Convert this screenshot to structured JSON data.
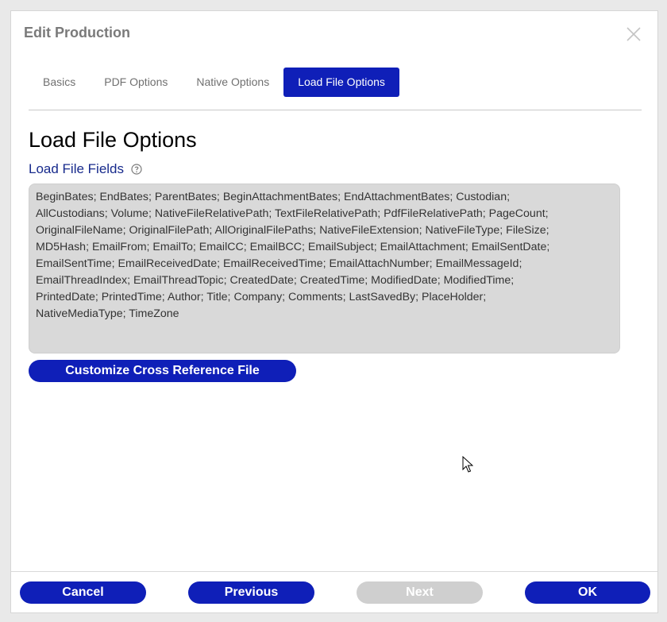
{
  "dialog": {
    "title": "Edit Production"
  },
  "tabs": [
    {
      "label": "Basics"
    },
    {
      "label": "PDF Options"
    },
    {
      "label": "Native Options"
    },
    {
      "label": "Load File Options"
    }
  ],
  "main": {
    "heading": "Load File Options",
    "section_label": "Load File Fields",
    "fields_text": "BeginBates; EndBates; ParentBates; BeginAttachmentBates; EndAttachmentBates; Custodian;\nAllCustodians; Volume; NativeFileRelativePath; TextFileRelativePath; PdfFileRelativePath; PageCount;\nOriginalFileName; OriginalFilePath; AllOriginalFilePaths; NativeFileExtension; NativeFileType; FileSize;\nMD5Hash; EmailFrom; EmailTo; EmailCC; EmailBCC; EmailSubject; EmailAttachment; EmailSentDate;\nEmailSentTime; EmailReceivedDate; EmailReceivedTime; EmailAttachNumber; EmailMessageId;\nEmailThreadIndex; EmailThreadTopic; CreatedDate; CreatedTime; ModifiedDate; ModifiedTime;\nPrintedDate; PrintedTime; Author; Title; Company; Comments; LastSavedBy; PlaceHolder;\nNativeMediaType; TimeZone",
    "customize_label": "Customize Cross Reference File"
  },
  "footer": {
    "cancel_label": "Cancel",
    "previous_label": "Previous",
    "next_label": "Next",
    "ok_label": "OK"
  },
  "colors": {
    "accent": "#0f1fb8",
    "label_blue": "#172a8c",
    "disabled": "#cfcfcf",
    "field_bg": "#d9d9d9"
  },
  "icons": {
    "close": "close-icon",
    "help": "help-icon",
    "cursor": "mouse-cursor-icon"
  }
}
